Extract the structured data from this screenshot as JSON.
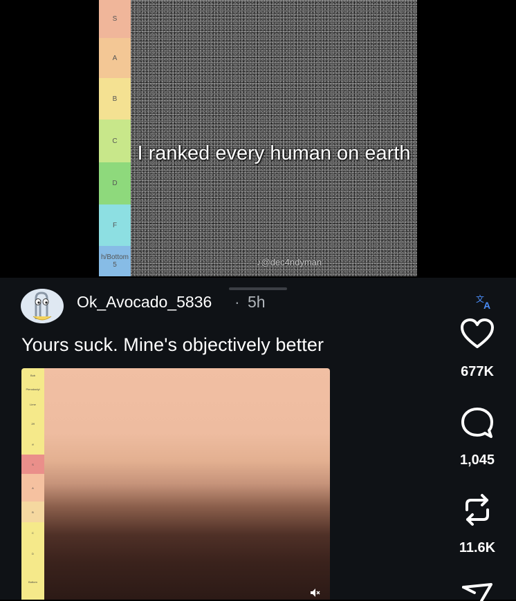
{
  "video": {
    "caption": "I ranked every human on earth",
    "watermark": "♪@dec4ndyman",
    "tiers": [
      {
        "label": "S",
        "color": "#f0b69a"
      },
      {
        "label": "A",
        "color": "#f3c795"
      },
      {
        "label": "B",
        "color": "#f4e192"
      },
      {
        "label": "C",
        "color": "#c8e78a"
      },
      {
        "label": "D",
        "color": "#8ed97c"
      },
      {
        "label": "F",
        "color": "#8ddfe2"
      },
      {
        "label": "h/Bottom 5",
        "color": "#87bce6"
      }
    ]
  },
  "comment": {
    "username": "Ok_Avocado_5836",
    "separator": "·",
    "timestamp": "5h",
    "text": "Yours suck. Mine's objectively better",
    "image_tiers": [
      {
        "label": "Bob",
        "color": "#f5e98a"
      },
      {
        "label": "Pterodactyl",
        "color": "#f5e98a"
      },
      {
        "label": "Lime",
        "color": "#f5e98a"
      },
      {
        "label": "2ff",
        "color": "#f5e98a"
      },
      {
        "label": "ff",
        "color": "#f5e98a"
      },
      {
        "label": "S",
        "color": "#ea8f8a"
      },
      {
        "label": "A",
        "color": "#f5c1a0"
      },
      {
        "label": "B",
        "color": "#f5d8a0"
      },
      {
        "label": "C",
        "color": "#f5e98a"
      },
      {
        "label": "D",
        "color": "#f5e98a"
      },
      {
        "label": "Bottom",
        "color": "#f5e98a"
      }
    ]
  },
  "actions": {
    "likes": "677K",
    "comments": "1,045",
    "reposts": "11.6K"
  },
  "icons": {
    "translate": "translate-icon",
    "like": "heart-icon",
    "comment": "speech-bubble-icon",
    "repost": "repost-icon",
    "share": "send-icon",
    "mute": "speaker-icon"
  }
}
